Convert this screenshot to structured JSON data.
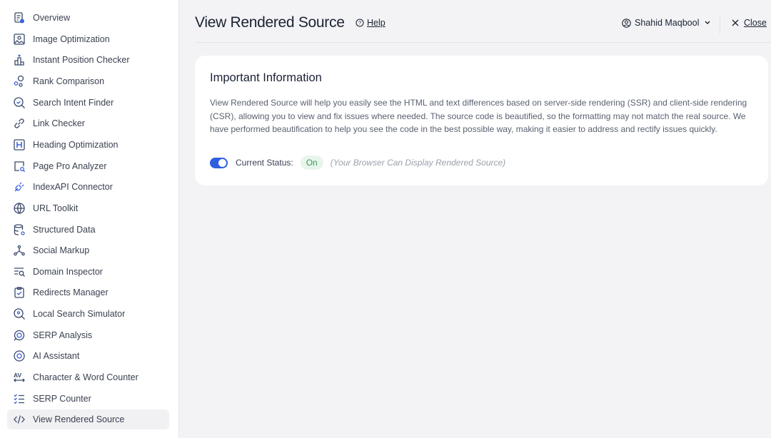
{
  "sidebar": {
    "items": [
      {
        "label": "Overview",
        "icon": "overview-icon"
      },
      {
        "label": "Image Optimization",
        "icon": "image-icon"
      },
      {
        "label": "Instant Position Checker",
        "icon": "podium-icon"
      },
      {
        "label": "Rank Comparison",
        "icon": "rank-compare-icon"
      },
      {
        "label": "Search Intent Finder",
        "icon": "search-check-icon"
      },
      {
        "label": "Link Checker",
        "icon": "link-icon"
      },
      {
        "label": "Heading Optimization",
        "icon": "heading-icon"
      },
      {
        "label": "Page Pro Analyzer",
        "icon": "page-search-icon"
      },
      {
        "label": "IndexAPI Connector",
        "icon": "plug-icon"
      },
      {
        "label": "URL Toolkit",
        "icon": "globe-icon"
      },
      {
        "label": "Structured Data",
        "icon": "database-icon"
      },
      {
        "label": "Social Markup",
        "icon": "share-icon"
      },
      {
        "label": "Domain Inspector",
        "icon": "list-search-icon"
      },
      {
        "label": "Redirects Manager",
        "icon": "clipboard-icon"
      },
      {
        "label": "Local Search Simulator",
        "icon": "location-search-icon"
      },
      {
        "label": "SERP Analysis",
        "icon": "serp-icon"
      },
      {
        "label": "AI Assistant",
        "icon": "ai-icon"
      },
      {
        "label": "Character & Word Counter",
        "icon": "av-icon"
      },
      {
        "label": "SERP Counter",
        "icon": "checklist-icon"
      },
      {
        "label": "View Rendered Source",
        "icon": "code-icon",
        "active": true
      }
    ]
  },
  "header": {
    "title": "View Rendered Source",
    "help": "Help",
    "user": "Shahid Maqbool",
    "close": "Close"
  },
  "card": {
    "title": "Important Information",
    "description": "View Rendered Source will help you easily see the HTML and text differences based on server-side rendering (SSR) and client-side rendering (CSR), allowing you to view and fix issues where needed. The source code is beautified, so the formatting may not match the real source. We have performed beautification to help you see the code in the best possible way, making it easier to address and rectify issues quickly.",
    "status_label": "Current Status:",
    "status_value": "On",
    "status_note": "(Your Browser Can Display Rendered Source)",
    "toggle_on": true
  },
  "colors": {
    "accent": "#2f5fe0",
    "badge_bg": "#e8f5ec",
    "badge_text": "#3a9a5a"
  }
}
